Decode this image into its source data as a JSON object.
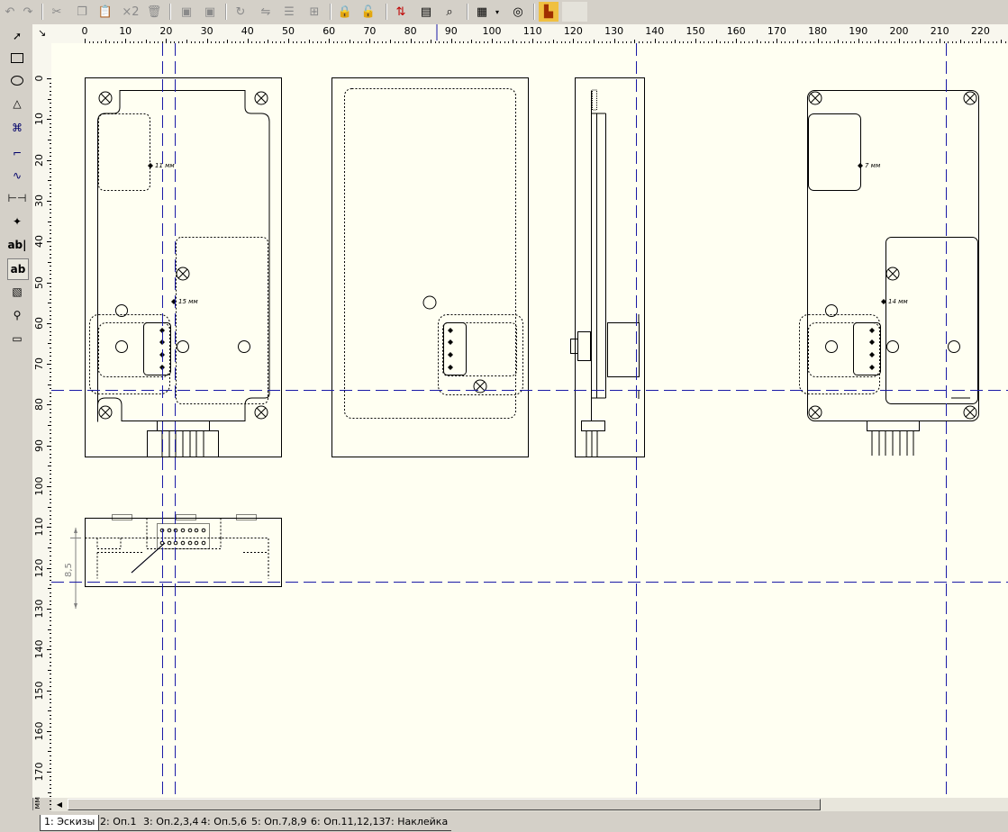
{
  "toolbar": {
    "buttons": [
      "undo-icon",
      "redo-icon",
      "cut-icon",
      "copy-icon",
      "paste-icon",
      "duplicate-icon",
      "delete-icon",
      "bring-front-icon",
      "send-back-icon",
      "rotate-icon",
      "flip-icon",
      "align-icon",
      "group-icon",
      "lock-icon",
      "unlock-icon",
      "numbering-icon",
      "properties-icon",
      "find-icon",
      "grid-icon",
      "zoom-icon",
      "layers-icon"
    ],
    "duplicate_label": "×2"
  },
  "tools": [
    "select-tool-icon",
    "rectangle-tool-icon",
    "ellipse-tool-icon",
    "polygon-tool-icon",
    "bezier-tool-icon",
    "polyline-tool-icon",
    "curve-tool-icon",
    "dimension-tool-icon",
    "point-tool-icon",
    "text-tool-icon",
    "textbox-tool-icon",
    "image-tool-icon",
    "zoom-tool-icon",
    "measure-tool-icon"
  ],
  "text_tool_label": "ab|",
  "textbox_tool_label": "ab",
  "ruler": {
    "h_ticks": [
      "0",
      "10",
      "20",
      "30",
      "40",
      "50",
      "60",
      "70",
      "80",
      "90",
      "100",
      "110",
      "120",
      "130",
      "140",
      "150",
      "160",
      "170",
      "180",
      "190",
      "200",
      "210",
      "220"
    ],
    "v_ticks": [
      "0",
      "10",
      "20",
      "30",
      "40",
      "50",
      "60",
      "70",
      "80",
      "90",
      "100",
      "110",
      "120",
      "130",
      "140",
      "150",
      "160",
      "170"
    ],
    "unit": "мм"
  },
  "annotations": {
    "label_11": "11 мм",
    "label_15": "15 мм",
    "label_7": "7 мм",
    "label_14": "14 мм",
    "dim_85": "8,5"
  },
  "tabs": [
    {
      "label": "1: Эскизы",
      "active": true
    },
    {
      "label": "2: Оп.1",
      "active": false
    },
    {
      "label": "3: Оп.2,3,4",
      "active": false
    },
    {
      "label": "4: Оп.5,6",
      "active": false
    },
    {
      "label": "5: Оп.7,8,9",
      "active": false
    },
    {
      "label": "6: Оп.11,12,13",
      "active": false
    },
    {
      "label": "7: Наклейка",
      "active": false
    }
  ],
  "colors": {
    "canvas": "#fffff2",
    "guide": "#1a1aa6",
    "drawing": "#000000"
  }
}
